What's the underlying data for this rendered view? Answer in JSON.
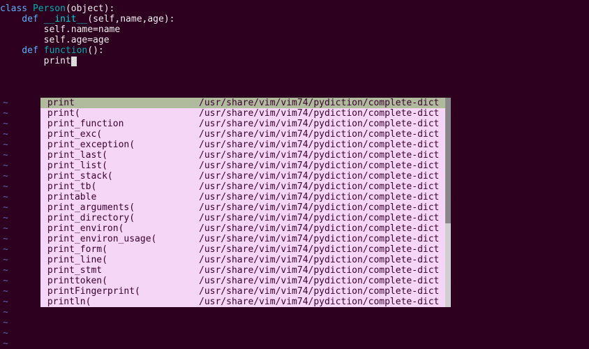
{
  "code": {
    "line1_class": "class ",
    "line1_name": "Person",
    "line1_rest": "(object):",
    "line2_def": "    def ",
    "line2_name": "__init__",
    "line2_params": "(self,name,age):",
    "line3": "        self.name=name",
    "line4": "        self.age=age",
    "line5": "",
    "line6_def": "    def ",
    "line6_name": "function",
    "line6_rest": "():",
    "line7_indent": "        ",
    "line7_text": "print"
  },
  "tilde": "~",
  "completion": {
    "source": "/usr/share/vim/vim74/pydiction/complete-dict",
    "items": [
      {
        "label": "print",
        "selected": true
      },
      {
        "label": "print(",
        "selected": false
      },
      {
        "label": "print_function",
        "selected": false
      },
      {
        "label": "print_exc(",
        "selected": false
      },
      {
        "label": "print_exception(",
        "selected": false
      },
      {
        "label": "print_last(",
        "selected": false
      },
      {
        "label": "print_list(",
        "selected": false
      },
      {
        "label": "print_stack(",
        "selected": false
      },
      {
        "label": "print_tb(",
        "selected": false
      },
      {
        "label": "printable",
        "selected": false
      },
      {
        "label": "print_arguments(",
        "selected": false
      },
      {
        "label": "print_directory(",
        "selected": false
      },
      {
        "label": "print_environ(",
        "selected": false
      },
      {
        "label": "print_environ_usage(",
        "selected": false
      },
      {
        "label": "print_form(",
        "selected": false
      },
      {
        "label": "print_line(",
        "selected": false
      },
      {
        "label": "print_stmt",
        "selected": false
      },
      {
        "label": "printtoken(",
        "selected": false
      },
      {
        "label": "printFingerprint(",
        "selected": false
      },
      {
        "label": "println(",
        "selected": false
      }
    ]
  },
  "tilde_count": 24
}
